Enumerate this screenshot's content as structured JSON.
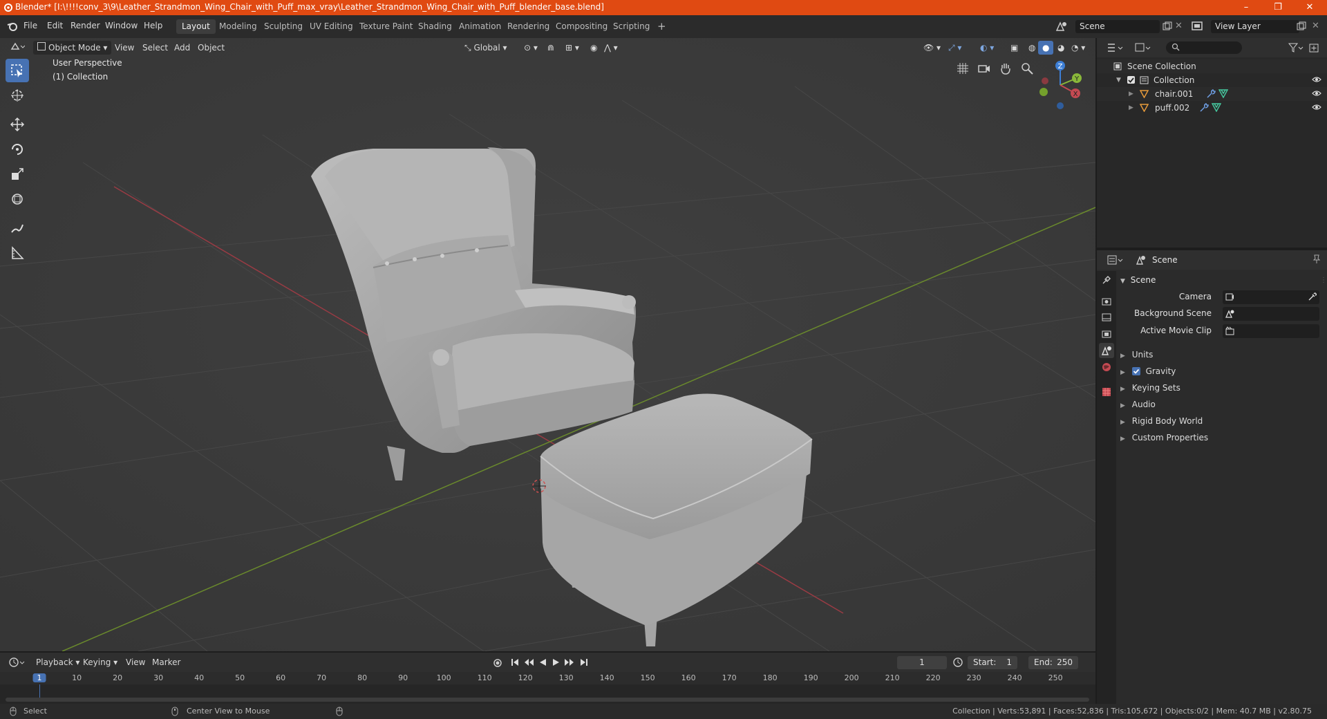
{
  "window": {
    "title": "Blender* [I:\\!!!!conv_3\\9\\Leather_Strandmon_Wing_Chair_with_Puff_max_vray\\Leather_Strandmon_Wing_Chair_with_Puff_blender_base.blend]",
    "controls": [
      "–",
      "❐",
      "✕"
    ]
  },
  "menu": [
    "File",
    "Edit",
    "Render",
    "Window",
    "Help"
  ],
  "workspaces": [
    "Layout",
    "Modeling",
    "Sculpting",
    "UV Editing",
    "Texture Paint",
    "Shading",
    "Animation",
    "Rendering",
    "Compositing",
    "Scripting"
  ],
  "add_workspace": "+",
  "scene_field": "Scene",
  "view_layer_field": "View Layer",
  "viewport": {
    "mode": "Object Mode",
    "menus": [
      "View",
      "Select",
      "Add",
      "Object"
    ],
    "orientation": "Global",
    "overlay_line1": "User Perspective",
    "overlay_line2": "(1) Collection",
    "gizmo": {
      "z": "Z",
      "y": "Y",
      "x": "X"
    }
  },
  "outliner": {
    "root": "Scene Collection",
    "collection": "Collection",
    "objects": [
      "chair.001",
      "puff.002"
    ]
  },
  "properties": {
    "header": "Scene",
    "section": "Scene",
    "fields": [
      {
        "label": "Camera"
      },
      {
        "label": "Background Scene"
      },
      {
        "label": "Active Movie Clip"
      }
    ],
    "panels": [
      {
        "label": "Units",
        "checkbox": false
      },
      {
        "label": "Gravity",
        "checkbox": true
      },
      {
        "label": "Keying Sets",
        "checkbox": false
      },
      {
        "label": "Audio",
        "checkbox": false
      },
      {
        "label": "Rigid Body World",
        "checkbox": false
      },
      {
        "label": "Custom Properties",
        "checkbox": false
      }
    ]
  },
  "timeline": {
    "menus": [
      "Playback",
      "Keying",
      "View",
      "Marker"
    ],
    "current_frame": "1",
    "start_label": "Start:",
    "start": "1",
    "end_label": "End:",
    "end": "250",
    "ruler": [
      "1",
      "10",
      "20",
      "30",
      "40",
      "50",
      "60",
      "70",
      "80",
      "90",
      "100",
      "110",
      "120",
      "130",
      "140",
      "150",
      "160",
      "170",
      "180",
      "190",
      "200",
      "210",
      "220",
      "230",
      "240",
      "250"
    ]
  },
  "status": {
    "left_action": "Select",
    "mid_action": "Center View to Mouse",
    "stats": "Collection | Verts:53,891 | Faces:52,836 | Tris:105,672 | Objects:0/2 | Mem: 40.7 MB | v2.80.75"
  },
  "colors": {
    "titlebar": "#e04a12",
    "active_tool": "#4772b3",
    "axis_x": "#c44a52",
    "axis_y": "#8ab83a",
    "axis_z": "#3d7fd6"
  }
}
